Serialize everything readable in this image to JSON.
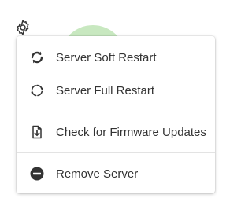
{
  "header": {
    "settings_icon": "gear-icon"
  },
  "menu": {
    "items": [
      {
        "label": "Server Soft Restart",
        "icon": "soft-restart-icon"
      },
      {
        "label": "Server Full Restart",
        "icon": "full-restart-icon"
      },
      {
        "label": "Check for Firmware Updates",
        "icon": "firmware-update-icon"
      },
      {
        "label": "Remove Server",
        "icon": "remove-icon"
      }
    ]
  },
  "colors": {
    "icon": "#333333",
    "text": "#333333",
    "status_circle": "#c8e8c0",
    "divider": "#e3e3e3"
  }
}
